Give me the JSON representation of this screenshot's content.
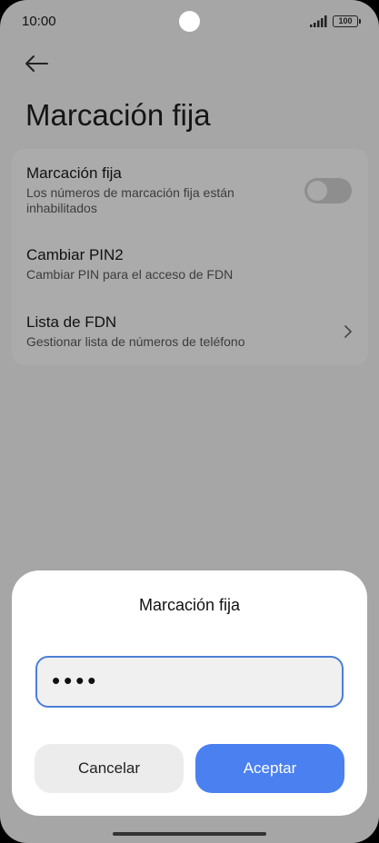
{
  "status_bar": {
    "time": "10:00",
    "battery": "100"
  },
  "page": {
    "title": "Marcación fija"
  },
  "settings": {
    "items": [
      {
        "title": "Marcación fija",
        "subtitle": "Los números de marcación fija están inhabilitados",
        "control": "toggle",
        "toggle_on": false
      },
      {
        "title": "Cambiar PIN2",
        "subtitle": "Cambiar PIN para el acceso de FDN"
      },
      {
        "title": "Lista de FDN",
        "subtitle": "Gestionar lista de números de teléfono",
        "control": "chevron-right-icon"
      }
    ]
  },
  "dialog": {
    "title": "Marcación fija",
    "pin_value": "••••",
    "cancel_label": "Cancelar",
    "accept_label": "Aceptar"
  },
  "colors": {
    "accent": "#4a80f0",
    "input_border": "#4a7fd6",
    "scrim": "#a6a6a6",
    "dialog_bg": "#ffffff"
  }
}
